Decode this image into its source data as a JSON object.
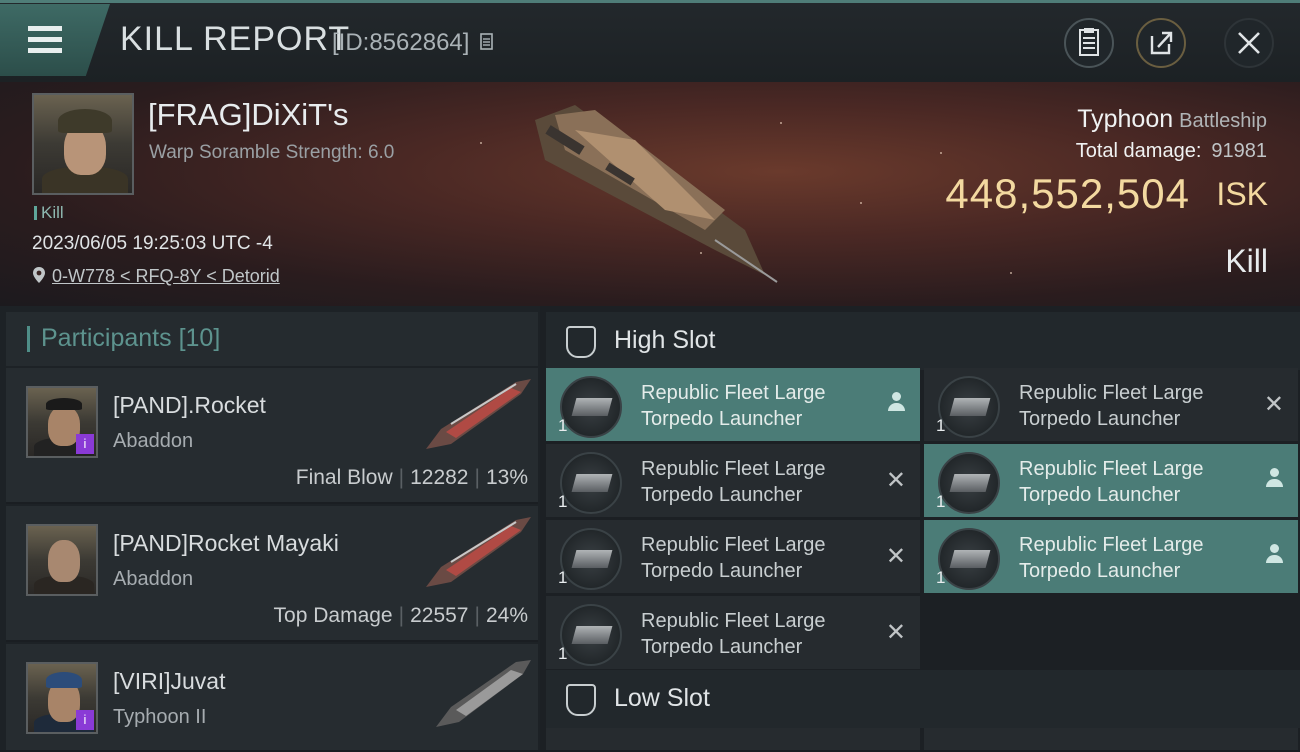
{
  "header": {
    "title": "KILL REPORT",
    "report_id": "[ID:8562864]",
    "icons": [
      "menu-icon",
      "copy-icon",
      "clipboard-icon",
      "share-icon",
      "close-icon"
    ]
  },
  "victim": {
    "name": "[FRAG]DiXiT's",
    "warp_scramble": "Warp Soramble Strength: 6.0",
    "tag": "Kill",
    "datetime": "2023/06/05 19:25:03 UTC -4",
    "location": "0-W778 < RFQ-8Y < Detorid",
    "ship_name": "Typhoon",
    "ship_class": "Battleship",
    "total_damage_label": "Total damage:",
    "total_damage": "91981",
    "isk_value": "448,552,504",
    "isk_unit": "ISK",
    "outcome": "Kill"
  },
  "participants": {
    "label": "Participants",
    "count": "[10]",
    "rows": [
      {
        "name": "[PAND].Rocket",
        "ship": "Abaddon",
        "role": "Final Blow",
        "damage": "12282",
        "percent": "13%",
        "badge": "i"
      },
      {
        "name": "[PAND]Rocket Mayaki",
        "ship": "Abaddon",
        "role": "Top Damage",
        "damage": "22557",
        "percent": "24%",
        "badge": ""
      },
      {
        "name": "[VIRI]Juvat",
        "ship": "Typhoon II",
        "role": "",
        "damage": "",
        "percent": "",
        "badge": "i"
      }
    ]
  },
  "slots": {
    "high": {
      "label": "High Slot",
      "items": [
        {
          "name1": "Republic Fleet Large",
          "name2": "Torpedo Launcher",
          "qty": "1",
          "state": "active"
        },
        {
          "name1": "Republic Fleet Large",
          "name2": "Torpedo Launcher",
          "qty": "1",
          "state": "destroyed"
        },
        {
          "name1": "Republic Fleet Large",
          "name2": "Torpedo Launcher",
          "qty": "1",
          "state": "destroyed"
        },
        {
          "name1": "Republic Fleet Large",
          "name2": "Torpedo Launcher",
          "qty": "1",
          "state": "active"
        },
        {
          "name1": "Republic Fleet Large",
          "name2": "Torpedo Launcher",
          "qty": "1",
          "state": "destroyed"
        },
        {
          "name1": "Republic Fleet Large",
          "name2": "Torpedo Launcher",
          "qty": "1",
          "state": "active"
        },
        {
          "name1": "Republic Fleet Large",
          "name2": "Torpedo Launcher",
          "qty": "1",
          "state": "destroyed"
        }
      ]
    },
    "low": {
      "label": "Low Slot"
    }
  },
  "colors": {
    "accent": "#4b7c77",
    "isk": "#f3d9a0",
    "badge": "#8a3ad6"
  }
}
